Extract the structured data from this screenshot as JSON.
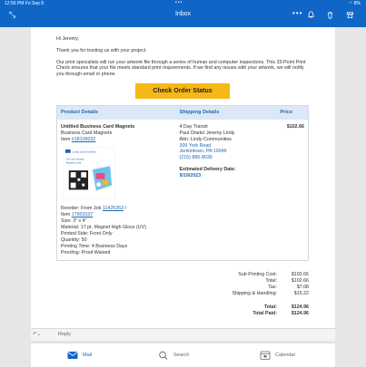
{
  "status": {
    "time": "12:56 PM",
    "day": "Fri Sep 8",
    "dots": "•••",
    "battery": "8%"
  },
  "app": {
    "title": "Inbox",
    "more_dots": "•••"
  },
  "email": {
    "greeting": "Hi Jeremy,",
    "thanks": "Thank you for trusting us with your project.",
    "body": "Our print specialists will run your artwork file through a series of human and computer inspections. This 33-Point Print Check ensures that your file meets standard print requirements. If we find any issues with your artwork, we will notify you through email or phone.",
    "cta_label": "Check Order Status",
    "table": {
      "headers": {
        "product": "Product Details",
        "shipping": "Shipping Details",
        "price": "Price"
      },
      "product": {
        "name": "Untitled Business Card Magnets",
        "type": "Business Card Magnets",
        "item_prefix": "Item ",
        "item_number": "#18109032",
        "thumb_logo": "Lindy Communities",
        "thumb_line1": "Get more broadly",
        "thumb_line2": "Business Card",
        "reorder_prefix": "Reorder: From Job ",
        "reorder_job": "11425363",
        "reorder_sep": " /",
        "reorder_item_prefix": "Item ",
        "reorder_item": "17903107",
        "size": "Size: 3\" x 4\"",
        "material": "Material: 17 pt. Magnet High Gloss (UV)",
        "printed_side": "Printed Side: Front Only",
        "quantity": "Quantity: 50",
        "printing_time": "Printing Time: 4 Business Days",
        "proofing": "Proofing: Proof Waived"
      },
      "shipping": {
        "method": "4 Day Transit",
        "name": "Paul Oneto/ Jeremy Lindy",
        "attn": "Attn: Lindy Communities",
        "street": "309 York Road",
        "city": "Jenkintown, PA 19046",
        "phone": "(215) 886-8030",
        "delivery_label": "Estimated Delivery Date:",
        "delivery_date": "9/19/2023"
      },
      "price": "$102.66"
    },
    "totals": [
      {
        "label": "Sub Printing Cost:",
        "value": "$102.66",
        "bold": false
      },
      {
        "label": "Total:",
        "value": "$102.66",
        "bold": false
      },
      {
        "label": "Tax:",
        "value": "$7.08",
        "bold": false
      },
      {
        "label": "Shipping & Handling:",
        "value": "$15.22",
        "bold": false
      },
      {
        "label": "Total:",
        "value": "$124.96",
        "bold": true
      },
      {
        "label": "Total Paid:",
        "value": "$124.96",
        "bold": true
      }
    ]
  },
  "reply": {
    "label": "Reply"
  },
  "nav": {
    "mail": "Mail",
    "search": "Search",
    "calendar": "Calendar"
  },
  "colors": {
    "brand": "#1066c6",
    "cta": "#f6b817",
    "link": "#1f66b3",
    "header_bg": "#dde8f6"
  },
  "icons": [
    "collapse-icon",
    "bell-icon",
    "trash-icon",
    "archive-icon",
    "reply-icon",
    "mail-icon",
    "search-icon",
    "calendar-icon"
  ]
}
